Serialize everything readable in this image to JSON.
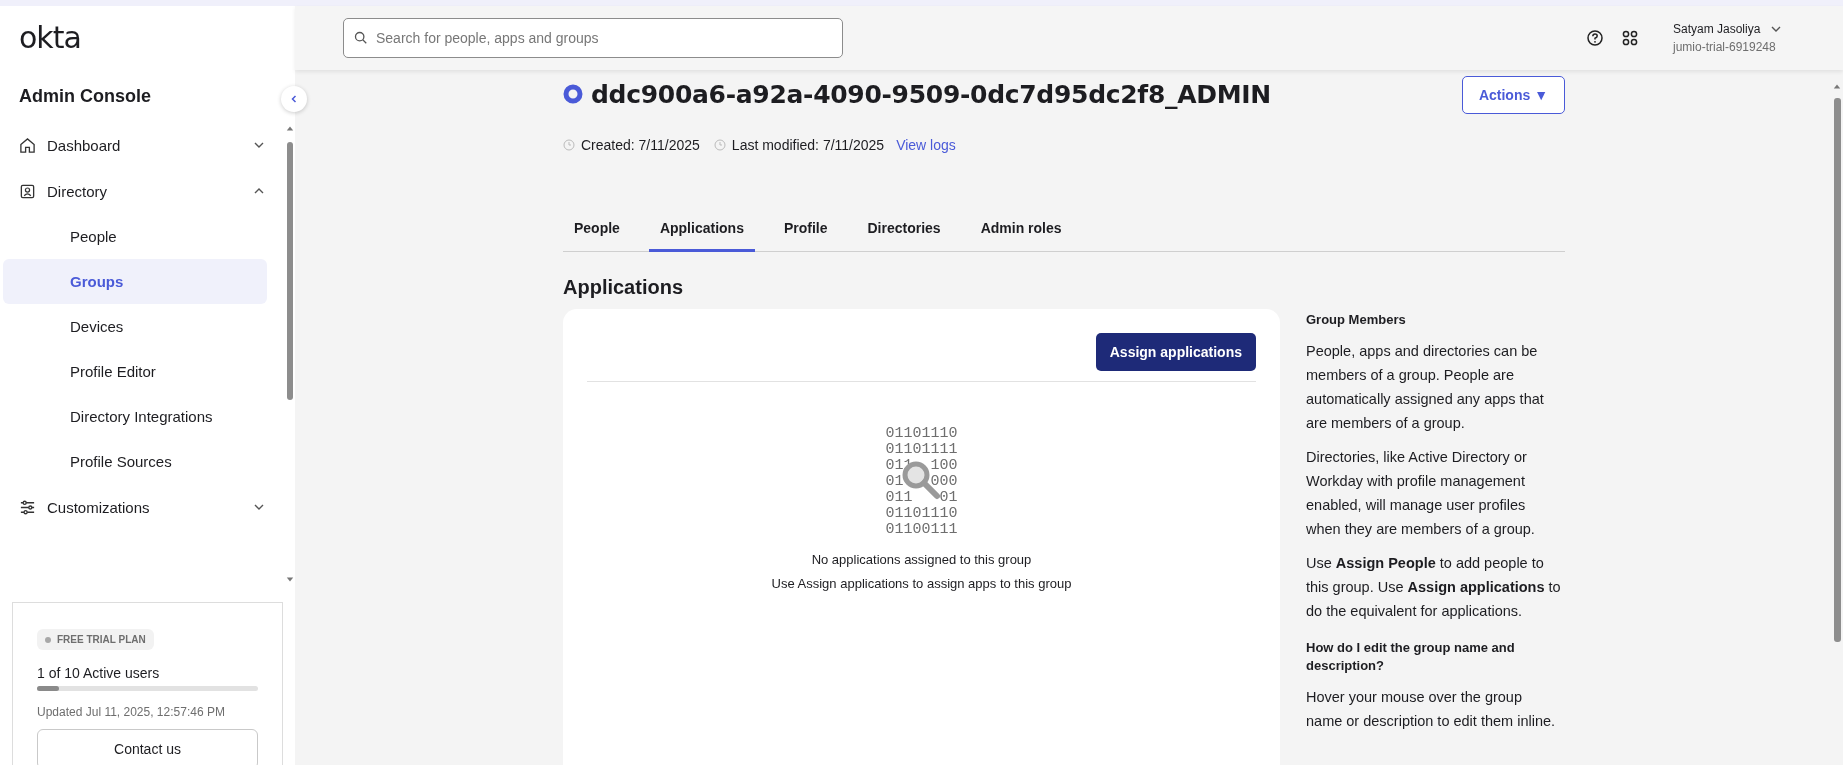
{
  "sidebar": {
    "logo": "okta",
    "title": "Admin Console",
    "nav": [
      {
        "label": "Dashboard",
        "expanded": false
      },
      {
        "label": "Directory",
        "expanded": true,
        "children": [
          {
            "label": "People",
            "selected": false
          },
          {
            "label": "Groups",
            "selected": true
          },
          {
            "label": "Devices",
            "selected": false
          },
          {
            "label": "Profile Editor",
            "selected": false
          },
          {
            "label": "Directory Integrations",
            "selected": false
          },
          {
            "label": "Profile Sources",
            "selected": false
          }
        ]
      },
      {
        "label": "Customizations",
        "expanded": false
      }
    ],
    "plan": {
      "badge": "FREE TRIAL PLAN",
      "users": "1 of 10 Active users",
      "level": 0.1,
      "updated": "Updated Jul 11, 2025, 12:57:46 PM",
      "button": "Contact us"
    }
  },
  "topbar": {
    "search": {
      "placeholder": "Search for people, apps and groups"
    },
    "user": {
      "name": "Satyam Jasoliya",
      "org": "jumio-trial-6919248"
    }
  },
  "group": {
    "name": "ddc900a6-a92a-4090-9509-0dc7d95dc2f8_ADMIN",
    "actions": "Actions ▼",
    "created": "Created: 7/11/2025",
    "modified": "Last modified: 7/11/2025",
    "logs": "View logs"
  },
  "tabs": [
    {
      "label": "People",
      "selected": false
    },
    {
      "label": "Applications",
      "selected": true
    },
    {
      "label": "Profile",
      "selected": false
    },
    {
      "label": "Directories",
      "selected": false
    },
    {
      "label": "Admin roles",
      "selected": false
    }
  ],
  "section": {
    "title": "Applications",
    "assign": "Assign applications",
    "binary": [
      "01101110",
      "01101111",
      "011  100",
      "01   000",
      "011   01",
      "01101110",
      "01100111"
    ],
    "empty_title": "No applications assigned to this group",
    "empty_hint": "Use Assign applications to assign apps to this group"
  },
  "help": [
    {
      "kind": "heading",
      "text": "Group Members"
    },
    {
      "kind": "paragraph",
      "text": "People, apps and directories can be members of a group. People are automatically assigned any apps that are members of a group."
    },
    {
      "kind": "paragraph",
      "text": "Directories, like Active Directory or Workday with profile management enabled, will manage user profiles when they are members of a group."
    },
    {
      "kind": "paragraph",
      "text": "Use **Assign People** to add people to this group. Use **Assign applications** to do the equivalent for applications."
    },
    {
      "kind": "heading",
      "text": "How do I edit the group name and description?"
    },
    {
      "kind": "paragraph",
      "text": "Hover your mouse over the group name or description to edit them inline."
    }
  ]
}
